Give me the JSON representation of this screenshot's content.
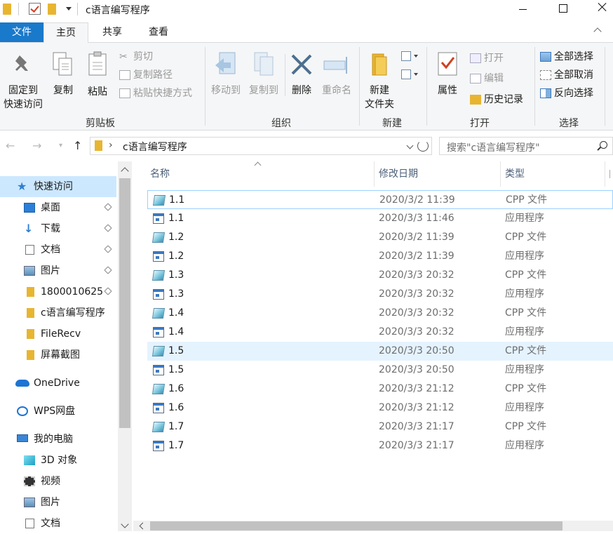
{
  "window": {
    "title": "c语言编写程序",
    "quick_access_icons": [
      "folder-icon",
      "properties-check-icon",
      "new-folder-icon",
      "customize-dropdown-icon"
    ]
  },
  "ribbon_tabs": [
    "文件",
    "主页",
    "共享",
    "查看"
  ],
  "ribbon": {
    "clipboard": {
      "label": "剪贴板",
      "pin": "固定到\n快速访问",
      "pin_line1": "固定到",
      "pin_line2": "快速访问",
      "copy": "复制",
      "paste": "粘贴",
      "cut": "剪切",
      "copy_path": "复制路径",
      "paste_shortcut": "粘贴快捷方式"
    },
    "organize": {
      "label": "组织",
      "move_to": "移动到",
      "copy_to": "复制到",
      "delete": "删除",
      "rename": "重命名"
    },
    "new": {
      "label": "新建",
      "new_folder_line1": "新建",
      "new_folder_line2": "文件夹"
    },
    "open": {
      "label": "打开",
      "properties": "属性",
      "open": "打开",
      "edit": "编辑",
      "history": "历史记录"
    },
    "select": {
      "label": "选择",
      "select_all": "全部选择",
      "select_none": "全部取消",
      "invert": "反向选择"
    }
  },
  "address": {
    "path": "c语言编写程序",
    "search_placeholder": "搜索\"c语言编写程序\""
  },
  "sidebar": {
    "items": [
      {
        "label": "快速访问",
        "icon": "star-icon",
        "pinned": false
      },
      {
        "label": "桌面",
        "icon": "desktop-icon",
        "pinned": true
      },
      {
        "label": "下载",
        "icon": "download-icon",
        "pinned": true
      },
      {
        "label": "文档",
        "icon": "document-icon",
        "pinned": true
      },
      {
        "label": "图片",
        "icon": "picture-icon",
        "pinned": true
      },
      {
        "label": "1800010625",
        "icon": "folder-icon",
        "pinned": true
      },
      {
        "label": "c语言编写程序",
        "icon": "folder-icon",
        "pinned": false
      },
      {
        "label": "FileRecv",
        "icon": "folder-icon",
        "pinned": false
      },
      {
        "label": "屏幕截图",
        "icon": "folder-icon",
        "pinned": false
      },
      {
        "label": "OneDrive",
        "icon": "onedrive-icon",
        "pinned": false
      },
      {
        "label": "WPS网盘",
        "icon": "wps-cloud-icon",
        "pinned": false
      },
      {
        "label": "我的电脑",
        "icon": "computer-icon",
        "pinned": false
      },
      {
        "label": "3D 对象",
        "icon": "3d-objects-icon",
        "pinned": false
      },
      {
        "label": "视频",
        "icon": "video-icon",
        "pinned": false
      },
      {
        "label": "图片",
        "icon": "picture-icon",
        "pinned": false
      },
      {
        "label": "文档",
        "icon": "document-icon",
        "pinned": false
      }
    ]
  },
  "list": {
    "columns": [
      "名称",
      "修改日期",
      "类型"
    ],
    "rows": [
      {
        "name": "1.1",
        "date": "2020/3/2 11:39",
        "type": "CPP 文件",
        "icon": "cpp-file-icon"
      },
      {
        "name": "1.1",
        "date": "2020/3/3 11:46",
        "type": "应用程序",
        "icon": "exe-file-icon"
      },
      {
        "name": "1.2",
        "date": "2020/3/2 11:39",
        "type": "CPP 文件",
        "icon": "cpp-file-icon"
      },
      {
        "name": "1.2",
        "date": "2020/3/2 11:39",
        "type": "应用程序",
        "icon": "exe-file-icon"
      },
      {
        "name": "1.3",
        "date": "2020/3/3 20:32",
        "type": "CPP 文件",
        "icon": "cpp-file-icon"
      },
      {
        "name": "1.3",
        "date": "2020/3/3 20:32",
        "type": "应用程序",
        "icon": "exe-file-icon"
      },
      {
        "name": "1.4",
        "date": "2020/3/3 20:32",
        "type": "CPP 文件",
        "icon": "cpp-file-icon"
      },
      {
        "name": "1.4",
        "date": "2020/3/3 20:32",
        "type": "应用程序",
        "icon": "exe-file-icon"
      },
      {
        "name": "1.5",
        "date": "2020/3/3 20:50",
        "type": "CPP 文件",
        "icon": "cpp-file-icon"
      },
      {
        "name": "1.5",
        "date": "2020/3/3 20:50",
        "type": "应用程序",
        "icon": "exe-file-icon"
      },
      {
        "name": "1.6",
        "date": "2020/3/3 21:12",
        "type": "CPP 文件",
        "icon": "cpp-file-icon"
      },
      {
        "name": "1.6",
        "date": "2020/3/3 21:12",
        "type": "应用程序",
        "icon": "exe-file-icon"
      },
      {
        "name": "1.7",
        "date": "2020/3/3 21:17",
        "type": "CPP 文件",
        "icon": "cpp-file-icon"
      },
      {
        "name": "1.7",
        "date": "2020/3/3 21:17",
        "type": "应用程序",
        "icon": "exe-file-icon"
      }
    ]
  },
  "colors": {
    "accent": "#1979ca",
    "selection": "#cce8ff",
    "hover": "#e5f3ff"
  }
}
